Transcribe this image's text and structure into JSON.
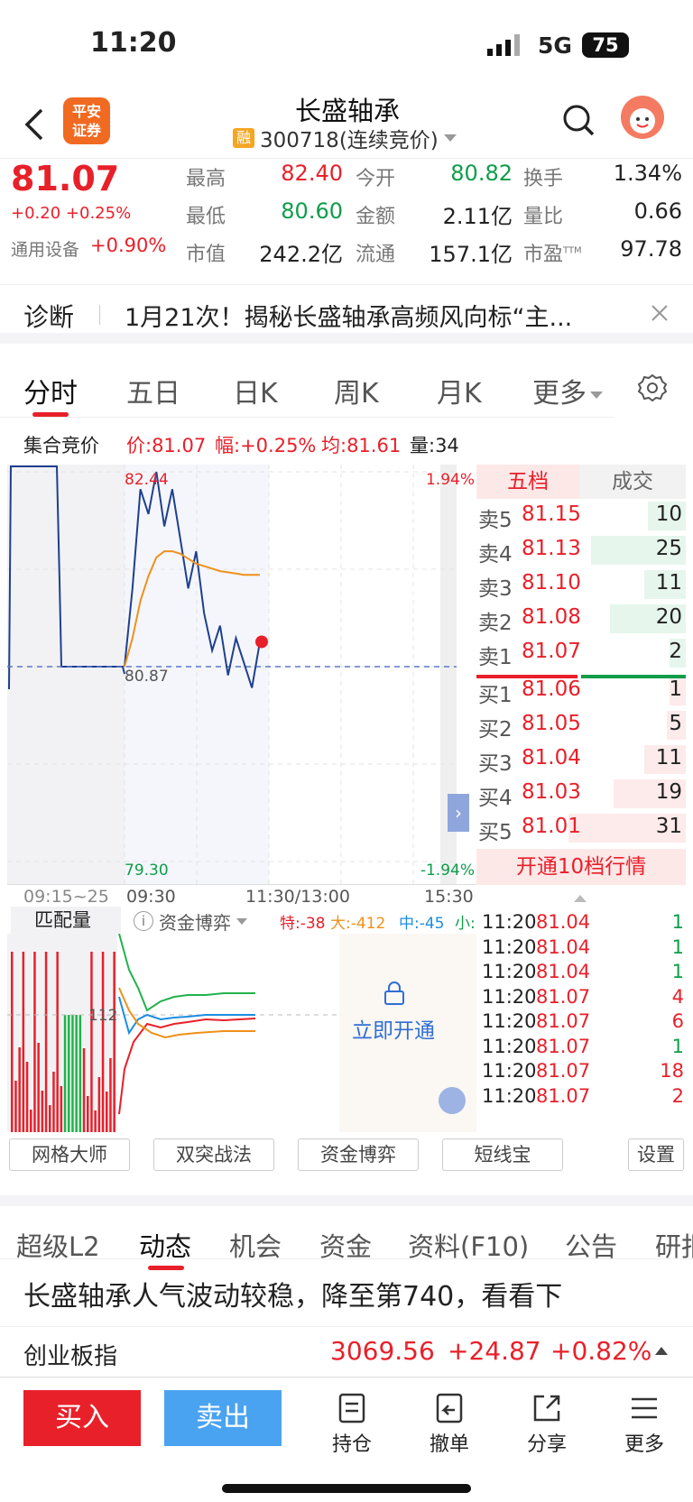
{
  "status": {
    "time": "11:20",
    "network": "5G",
    "battery": "75"
  },
  "header": {
    "broker": "平安\n证券",
    "stock_name": "长盛轴承",
    "tag": "融",
    "code": "300718(连续竞价)"
  },
  "quote": {
    "price": "81.07",
    "change": "+0.20",
    "change_pct": "+0.25%",
    "sector": "通用设备",
    "sector_pct": "+0.90%",
    "high_label": "最高",
    "high": "82.40",
    "open_label": "今开",
    "open": "80.82",
    "turnover_label": "换手",
    "turnover": "1.34%",
    "low_label": "最低",
    "low": "80.60",
    "amount_label": "金额",
    "amount": "2.11亿",
    "vol_ratio_label": "量比",
    "vol_ratio": "0.66",
    "mktcap_label": "市值",
    "mktcap": "242.2亿",
    "float_label": "流通",
    "float": "157.1亿",
    "pe_label": "市盈",
    "pe_sup": "TTM",
    "pe": "97.78"
  },
  "diagnosis": {
    "label": "诊断",
    "text": "1月21次！揭秘长盛轴承高频风向标“主..."
  },
  "chart_tabs": [
    "分时",
    "五日",
    "日K",
    "周K",
    "月K",
    "更多"
  ],
  "auction": {
    "label": "集合竞价",
    "price": "价:81.07",
    "range": "幅:+0.25%",
    "avg": "均:81.61",
    "vol": "量:34"
  },
  "chart_labels": {
    "high_price": "82.44",
    "pre_close": "80.87",
    "low_price": "79.30",
    "high_pct": "1.94%",
    "low_pct": "-1.94%",
    "t_auction": "09:15~25",
    "t_open": "09:30",
    "t_mid": "11:30/13:00",
    "t_close": "15:30"
  },
  "vol_panel": {
    "match_label": "匹配量",
    "fund_label": "资金博弈",
    "special": "特:-38",
    "large": "大:-412",
    "medium": "中:-45",
    "small": "小:",
    "mid_value": "112",
    "unlock": "立即开通"
  },
  "chart_data": {
    "type": "line",
    "title": "",
    "series": [
      {
        "name": "",
        "values": [
          80.87,
          81.5,
          82.3,
          82.1,
          82.44,
          82.0,
          82.3,
          81.9,
          81.5,
          81.8,
          81.3,
          81.0,
          81.2,
          80.8,
          81.1,
          80.9,
          80.7,
          81.07
        ]
      },
      {
        "name": "",
        "values": [
          80.87,
          81.1,
          81.4,
          81.6,
          81.75,
          81.8,
          81.8,
          81.78,
          81.74,
          81.7,
          81.68,
          81.66,
          81.64,
          81.63,
          81.62,
          81.61,
          81.61,
          81.61
        ]
      }
    ],
    "ylim": [
      79.3,
      82.44
    ],
    "reference": 80.87,
    "xlabels": [
      "09:15~25",
      "09:30",
      "11:30/13:00",
      "15:30"
    ]
  },
  "order_book": {
    "tab_active": "五档",
    "tab_other": "成交",
    "asks": [
      {
        "label": "卖5",
        "price": "81.15",
        "vol": "10"
      },
      {
        "label": "卖4",
        "price": "81.13",
        "vol": "25"
      },
      {
        "label": "卖3",
        "price": "81.10",
        "vol": "11"
      },
      {
        "label": "卖2",
        "price": "81.08",
        "vol": "20"
      },
      {
        "label": "卖1",
        "price": "81.07",
        "vol": "2"
      }
    ],
    "bids": [
      {
        "label": "买1",
        "price": "81.06",
        "vol": "1"
      },
      {
        "label": "买2",
        "price": "81.05",
        "vol": "5"
      },
      {
        "label": "买3",
        "price": "81.04",
        "vol": "11"
      },
      {
        "label": "买4",
        "price": "81.03",
        "vol": "19"
      },
      {
        "label": "买5",
        "price": "81.01",
        "vol": "31"
      }
    ],
    "upgrade": "开通10档行情"
  },
  "ticks": [
    {
      "t": "11:20",
      "p": "81.04",
      "v": "1",
      "c": "green"
    },
    {
      "t": "11:20",
      "p": "81.04",
      "v": "1",
      "c": "green"
    },
    {
      "t": "11:20",
      "p": "81.04",
      "v": "1",
      "c": "green"
    },
    {
      "t": "11:20",
      "p": "81.07",
      "v": "4",
      "c": "red"
    },
    {
      "t": "11:20",
      "p": "81.07",
      "v": "6",
      "c": "red"
    },
    {
      "t": "11:20",
      "p": "81.07",
      "v": "1",
      "c": "green"
    },
    {
      "t": "11:20",
      "p": "81.07",
      "v": "18",
      "c": "red"
    },
    {
      "t": "11:20",
      "p": "81.07",
      "v": "2",
      "c": "red"
    }
  ],
  "tools": [
    "网格大师",
    "双突战法",
    "资金博弈",
    "短线宝",
    "设置"
  ],
  "section_tabs": [
    "超级L2",
    "动态",
    "机会",
    "资金",
    "资料(F10)",
    "公告",
    "研报"
  ],
  "news": "长盛轴承人气波动较稳，降至第740，看看下",
  "index": {
    "name": "创业板指",
    "value": "3069.56",
    "change": "+24.87",
    "pct": "+0.82%"
  },
  "bottom": {
    "buy": "买入",
    "sell": "卖出",
    "hold": "持仓",
    "cancel": "撤单",
    "share": "分享",
    "more": "更多"
  },
  "colors": {
    "up": "#e8202a",
    "down": "#0f9d4a",
    "price_line": "#1f3f8f",
    "avg_line": "#f0901a",
    "sell_btn": "#4aa3f0"
  }
}
